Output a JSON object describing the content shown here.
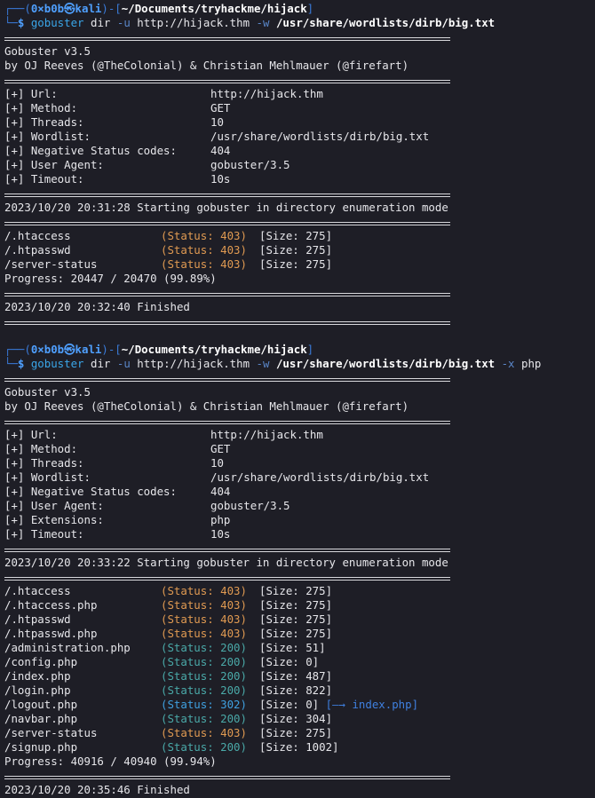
{
  "prompt": {
    "user": "0×b0b",
    "at": "㉿",
    "host": "kali",
    "path1": "~/Documents/tryhackme/hijack",
    "path2": "~/Documents/tryhackme/hijack"
  },
  "run1": {
    "cmd": "gobuster",
    "sub": "dir",
    "flag_u": "-u",
    "url": "http://hijack.thm",
    "flag_w": "-w",
    "wordlist": "/usr/share/wordlists/dirb/big.txt",
    "banner1": "Gobuster v3.5",
    "banner2": "by OJ Reeves (@TheColonial) & Christian Mehlmauer (@firefart)",
    "config": [
      {
        "k": "[+] Url:",
        "v": "http://hijack.thm"
      },
      {
        "k": "[+] Method:",
        "v": "GET"
      },
      {
        "k": "[+] Threads:",
        "v": "10"
      },
      {
        "k": "[+] Wordlist:",
        "v": "/usr/share/wordlists/dirb/big.txt"
      },
      {
        "k": "[+] Negative Status codes:",
        "v": "404"
      },
      {
        "k": "[+] User Agent:",
        "v": "gobuster/3.5"
      },
      {
        "k": "[+] Timeout:",
        "v": "10s"
      }
    ],
    "start": "2023/10/20 20:31:28 Starting gobuster in directory enumeration mode",
    "results": [
      {
        "path": "/.htaccess",
        "status": "(Status: 403)",
        "size": "[Size: 275]",
        "code": "403"
      },
      {
        "path": "/.htpasswd",
        "status": "(Status: 403)",
        "size": "[Size: 275]",
        "code": "403"
      },
      {
        "path": "/server-status",
        "status": "(Status: 403)",
        "size": "[Size: 275]",
        "code": "403"
      }
    ],
    "progress": "Progress: 20447 / 20470 (99.89%)",
    "finished": "2023/10/20 20:32:40 Finished"
  },
  "run2": {
    "cmd": "gobuster",
    "sub": "dir",
    "flag_u": "-u",
    "url": "http://hijack.thm",
    "flag_w": "-w",
    "wordlist": "/usr/share/wordlists/dirb/big.txt",
    "flag_x": "-x",
    "ext": "php",
    "banner1": "Gobuster v3.5",
    "banner2": "by OJ Reeves (@TheColonial) & Christian Mehlmauer (@firefart)",
    "config": [
      {
        "k": "[+] Url:",
        "v": "http://hijack.thm"
      },
      {
        "k": "[+] Method:",
        "v": "GET"
      },
      {
        "k": "[+] Threads:",
        "v": "10"
      },
      {
        "k": "[+] Wordlist:",
        "v": "/usr/share/wordlists/dirb/big.txt"
      },
      {
        "k": "[+] Negative Status codes:",
        "v": "404"
      },
      {
        "k": "[+] User Agent:",
        "v": "gobuster/3.5"
      },
      {
        "k": "[+] Extensions:",
        "v": "php"
      },
      {
        "k": "[+] Timeout:",
        "v": "10s"
      }
    ],
    "start": "2023/10/20 20:33:22 Starting gobuster in directory enumeration mode",
    "results": [
      {
        "path": "/.htaccess",
        "status": "(Status: 403)",
        "size": "[Size: 275]",
        "code": "403"
      },
      {
        "path": "/.htaccess.php",
        "status": "(Status: 403)",
        "size": "[Size: 275]",
        "code": "403"
      },
      {
        "path": "/.htpasswd",
        "status": "(Status: 403)",
        "size": "[Size: 275]",
        "code": "403"
      },
      {
        "path": "/.htpasswd.php",
        "status": "(Status: 403)",
        "size": "[Size: 275]",
        "code": "403"
      },
      {
        "path": "/administration.php",
        "status": "(Status: 200)",
        "size": "[Size: 51]",
        "code": "200"
      },
      {
        "path": "/config.php",
        "status": "(Status: 200)",
        "size": "[Size: 0]",
        "code": "200"
      },
      {
        "path": "/index.php",
        "status": "(Status: 200)",
        "size": "[Size: 487]",
        "code": "200"
      },
      {
        "path": "/login.php",
        "status": "(Status: 200)",
        "size": "[Size: 822]",
        "code": "200"
      },
      {
        "path": "/logout.php",
        "status": "(Status: 302)",
        "size": "[Size: 0]",
        "code": "302",
        "redirect": "[—→ index.php]"
      },
      {
        "path": "/navbar.php",
        "status": "(Status: 200)",
        "size": "[Size: 304]",
        "code": "200"
      },
      {
        "path": "/server-status",
        "status": "(Status: 403)",
        "size": "[Size: 275]",
        "code": "403"
      },
      {
        "path": "/signup.php",
        "status": "(Status: 200)",
        "size": "[Size: 1002]",
        "code": "200"
      }
    ],
    "progress": "Progress: 40916 / 40940 (99.94%)",
    "finished": "2023/10/20 20:35:46 Finished"
  }
}
